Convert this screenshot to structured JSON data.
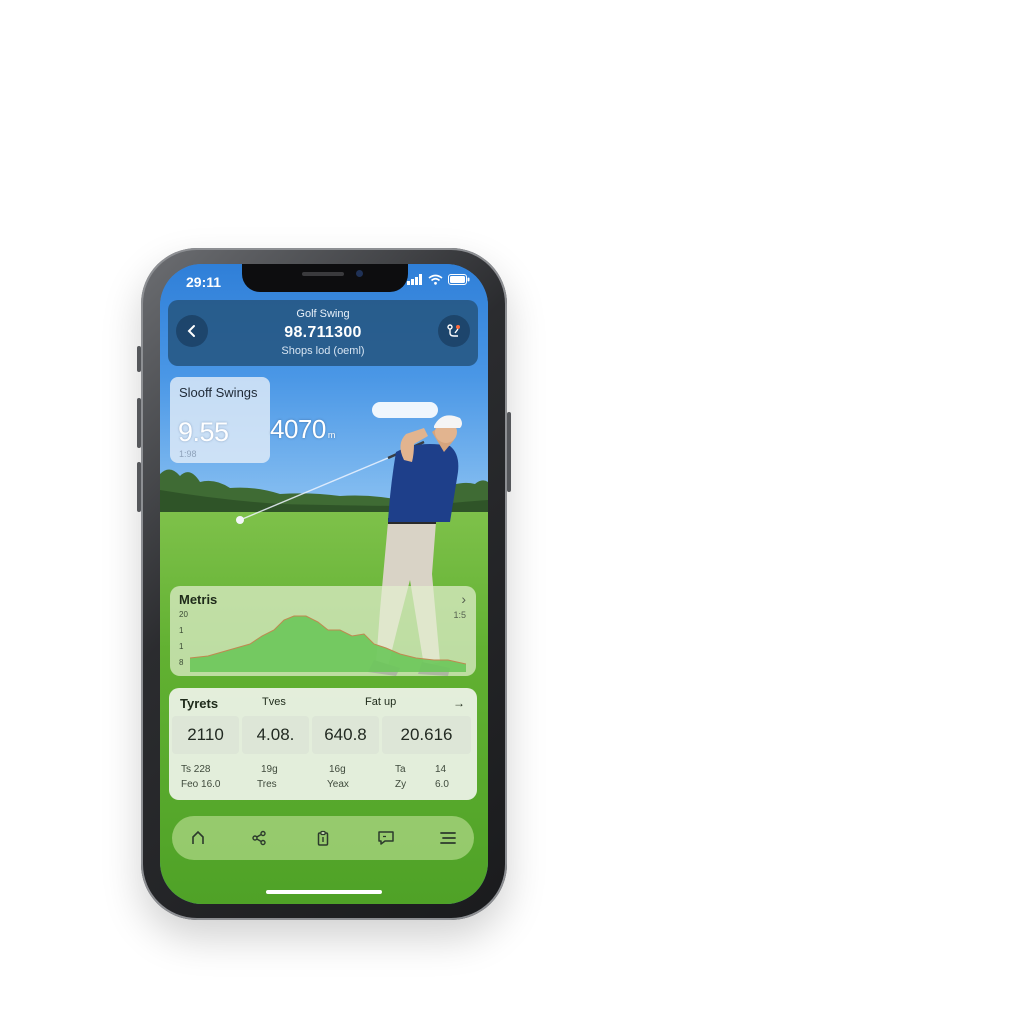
{
  "status_bar": {
    "time": "29:11"
  },
  "header": {
    "title": "Golf Swing",
    "value": "98.711300",
    "subtitle": "Shops lod (oeml)"
  },
  "swings_card": {
    "title": "Slooff Swings",
    "big_value": "9.55",
    "small_value": "1:98"
  },
  "overlay": {
    "value": "4070",
    "unit": "m"
  },
  "metrics": {
    "title": "Metris",
    "right_value": "1:5",
    "y_ticks": [
      "20",
      "1",
      "1",
      "8"
    ]
  },
  "table": {
    "headers": [
      "Tyrets",
      "Tves",
      "Fat up"
    ],
    "values": [
      "2110",
      "4.08.",
      "640.8",
      "20.616"
    ],
    "sub_row_1": [
      "Ts 228",
      "19g",
      "16g",
      "Ta",
      "14"
    ],
    "sub_row_2": [
      "Feo 16.0",
      "Tres",
      "Yeax",
      "Zy",
      "6.0"
    ]
  },
  "bottom_nav": {
    "items": [
      "home-icon",
      "share-icon",
      "clipboard-icon",
      "chat-icon",
      "menu-icon"
    ]
  },
  "colors": {
    "sky": "#2f7fd8",
    "grass": "#62b132",
    "header_bg": "#265682",
    "metrics_area": "#6cc75a"
  }
}
